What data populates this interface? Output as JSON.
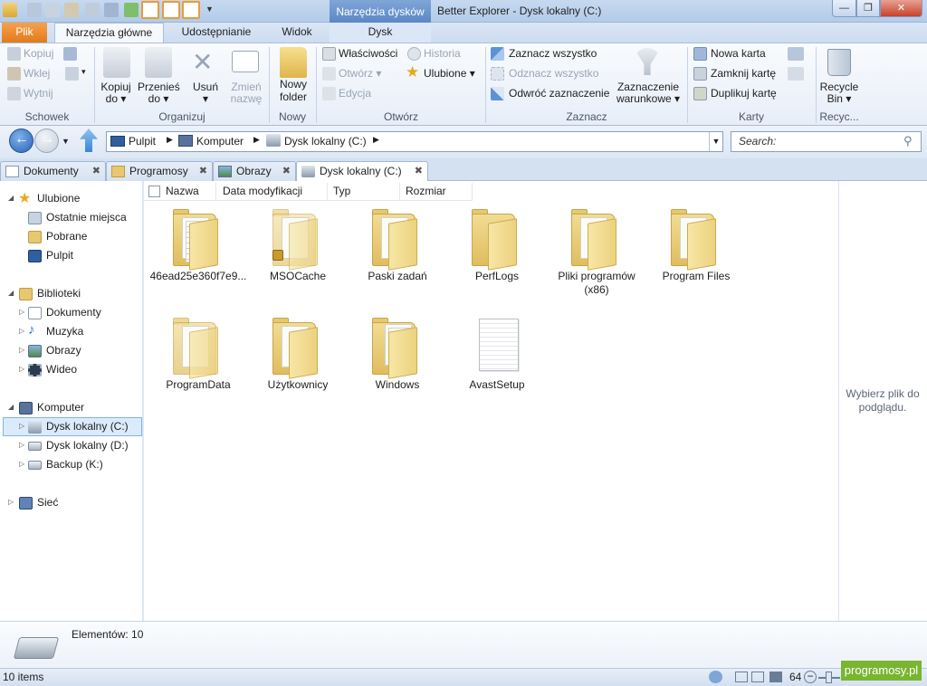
{
  "window": {
    "title": "Better Explorer - Dysk lokalny (C:)",
    "context_tab_header": "Narzędzia dysków",
    "min_glyph": "—",
    "max_glyph": "❐",
    "close_glyph": "✕"
  },
  "ribbon_tabs": {
    "file": "Plik",
    "home": "Narzędzia główne",
    "share": "Udostępnianie",
    "view": "Widok",
    "disk": "Dysk"
  },
  "ribbon": {
    "clipboard": {
      "label": "Schowek",
      "copy": "Kopiuj",
      "paste": "Wklej",
      "cut": "Wytnij"
    },
    "organize": {
      "label": "Organizuj",
      "copy_to_1": "Kopiuj",
      "copy_to_2": "do ▾",
      "move_to_1": "Przenieś",
      "move_to_2": "do ▾",
      "delete_1": "Usuń",
      "delete_2": "▾",
      "rename_1": "Zmień",
      "rename_2": "nazwę"
    },
    "new": {
      "label": "Nowy",
      "new_folder_1": "Nowy",
      "new_folder_2": "folder"
    },
    "open": {
      "label": "Otwórz",
      "properties": "Właściwości",
      "history": "Historia",
      "open": "Otwórz ▾",
      "favorites": "Ulubione ▾",
      "edit": "Edycja"
    },
    "select": {
      "label": "Zaznacz",
      "select_all": "Zaznacz wszystko",
      "select_none": "Odznacz wszystko",
      "invert": "Odwróć zaznaczenie",
      "conditional_1": "Zaznaczenie",
      "conditional_2": "warunkowe ▾"
    },
    "tabs": {
      "label": "Karty",
      "new_tab": "Nowa karta",
      "close_tab": "Zamknij kartę",
      "duplicate_tab": "Duplikuj kartę"
    },
    "recycle": {
      "label": "Recyc...",
      "btn_1": "Recycle",
      "btn_2": "Bin ▾"
    }
  },
  "address": {
    "crumbs": [
      "Pulpit",
      "Komputer",
      "Dysk lokalny (C:)"
    ],
    "search_placeholder": "Search:"
  },
  "doc_tabs": [
    {
      "label": "Dokumenty",
      "active": false
    },
    {
      "label": "Programosy",
      "active": false
    },
    {
      "label": "Obrazy",
      "active": false
    },
    {
      "label": "Dysk lokalny (C:)",
      "active": true
    }
  ],
  "nav_tree": {
    "favorites": {
      "label": "Ulubione",
      "children": [
        "Ostatnie miejsca",
        "Pobrane",
        "Pulpit"
      ]
    },
    "libraries": {
      "label": "Biblioteki",
      "children": [
        "Dokumenty",
        "Muzyka",
        "Obrazy",
        "Wideo"
      ]
    },
    "computer": {
      "label": "Komputer",
      "children": [
        "Dysk lokalny (C:)",
        "Dysk lokalny (D:)",
        "Backup (K:)"
      ]
    },
    "network": {
      "label": "Sieć"
    }
  },
  "columns": [
    "Nazwa",
    "Data modyfikacji",
    "Typ",
    "Rozmiar"
  ],
  "items": [
    {
      "name": "46ead25e360f7e9...",
      "kind": "folder-docs"
    },
    {
      "name": "MSOCache",
      "kind": "folder-locked"
    },
    {
      "name": "Paski zadań",
      "kind": "folder"
    },
    {
      "name": "PerfLogs",
      "kind": "folder-empty"
    },
    {
      "name": "Pliki programów\n(x86)",
      "kind": "folder"
    },
    {
      "name": "Program Files",
      "kind": "folder"
    },
    {
      "name": "ProgramData",
      "kind": "folder"
    },
    {
      "name": "Użytkownicy",
      "kind": "folder"
    },
    {
      "name": "Windows",
      "kind": "folder-docs"
    },
    {
      "name": "AvastSetup",
      "kind": "file"
    }
  ],
  "preview": {
    "empty_text": "Wybierz plik do podglądu."
  },
  "details": {
    "count": "Elementów: 10"
  },
  "status": {
    "items": "10 items",
    "zoom": "64"
  },
  "watermark": "programosy.pl",
  "colors": {
    "accent": "#3b74c7",
    "file_tab": "#e8871f",
    "folder": "#e6c66c",
    "selection": "#dcebfc"
  }
}
